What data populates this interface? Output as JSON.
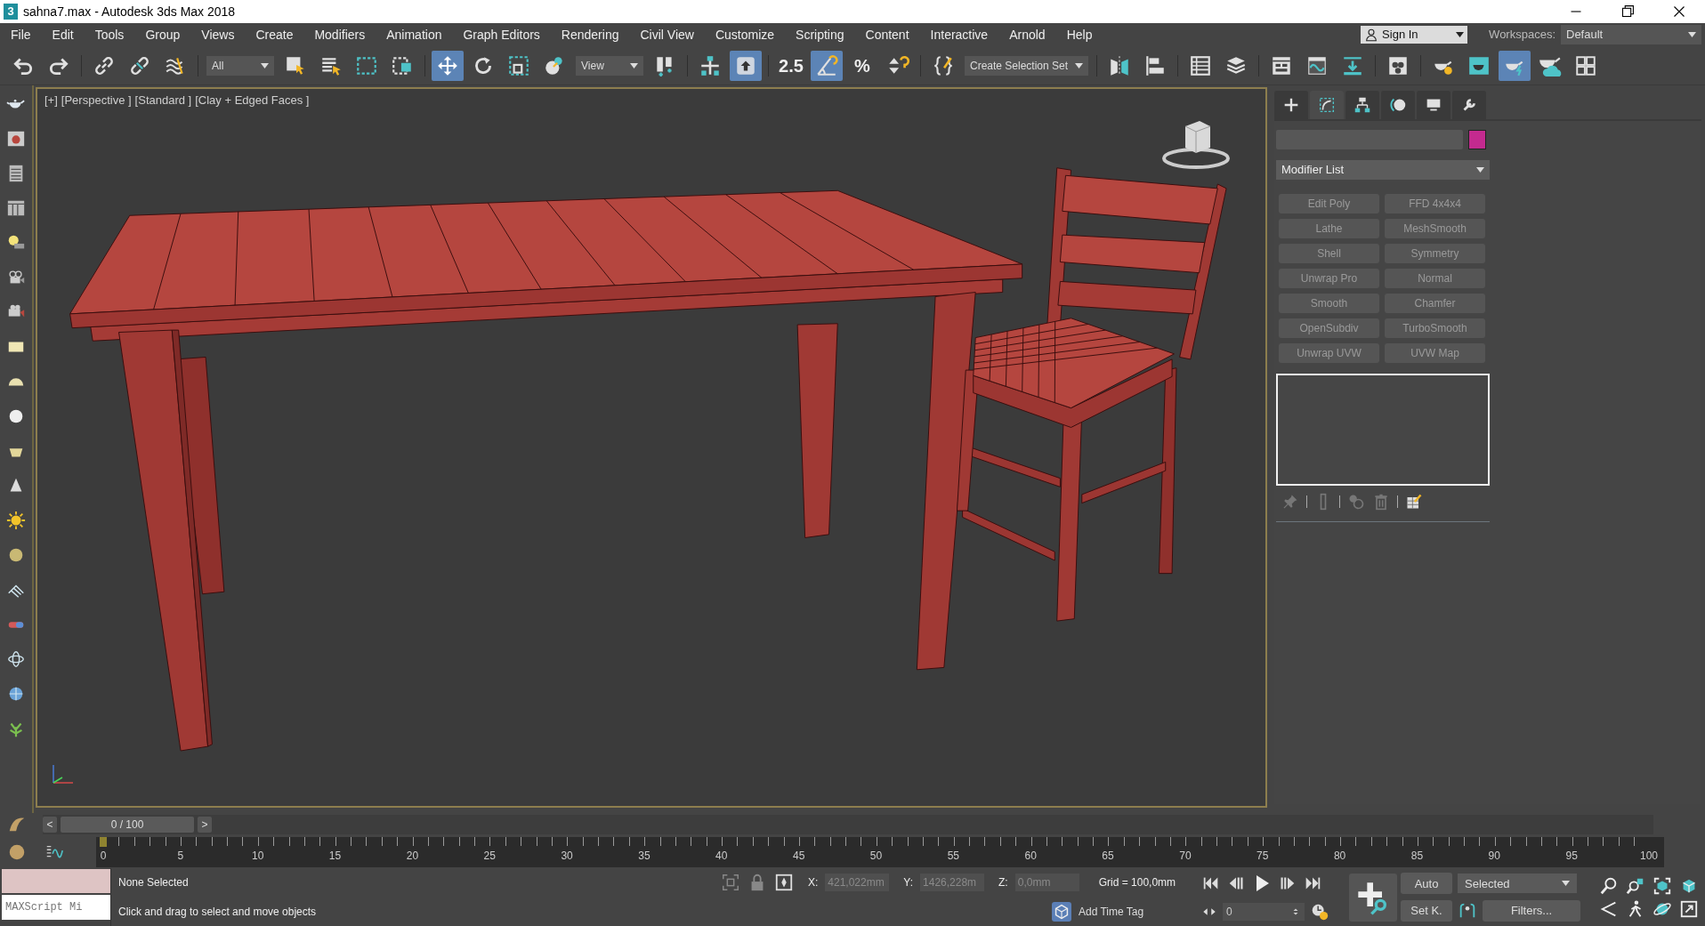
{
  "window": {
    "logo": "3",
    "title": "sahna7.max - Autodesk 3ds Max 2018"
  },
  "menu": [
    "File",
    "Edit",
    "Tools",
    "Group",
    "Views",
    "Create",
    "Modifiers",
    "Animation",
    "Graph Editors",
    "Rendering",
    "Civil View",
    "Customize",
    "Scripting",
    "Content",
    "Interactive",
    "Arnold",
    "Help"
  ],
  "account": {
    "label": "Sign In"
  },
  "workspaces": {
    "label": "Workspaces:",
    "value": "Default"
  },
  "toolbar": [
    {
      "kind": "icon",
      "on": false
    },
    {
      "kind": "icon",
      "on": false
    },
    {
      "kind": "separator"
    },
    {
      "kind": "icon",
      "on": false
    },
    {
      "kind": "icon",
      "on": false
    },
    {
      "kind": "icon",
      "on": false
    },
    {
      "kind": "separator"
    },
    {
      "kind": "dropdown",
      "value": "All"
    },
    {
      "kind": "icon",
      "on": false
    },
    {
      "kind": "icon",
      "on": false
    },
    {
      "kind": "icon",
      "on": false
    },
    {
      "kind": "icon",
      "on": false
    },
    {
      "kind": "separator"
    },
    {
      "kind": "icon",
      "on": true
    },
    {
      "kind": "icon",
      "on": false
    },
    {
      "kind": "icon",
      "on": false
    },
    {
      "kind": "icon",
      "on": false
    },
    {
      "kind": "dropdown",
      "value": "View"
    },
    {
      "kind": "icon",
      "on": false
    },
    {
      "kind": "separator"
    },
    {
      "kind": "icon",
      "on": false
    },
    {
      "kind": "icon",
      "on": true
    },
    {
      "kind": "separator"
    },
    {
      "kind": "text",
      "label": "2.5",
      "on": false
    },
    {
      "kind": "icon",
      "on": true
    },
    {
      "kind": "text",
      "label": "%",
      "on": false
    },
    {
      "kind": "icon",
      "on": false
    },
    {
      "kind": "separator"
    },
    {
      "kind": "icon",
      "on": false
    },
    {
      "kind": "dropdown",
      "value": "Create Selection Set"
    },
    {
      "kind": "separator"
    },
    {
      "kind": "icon",
      "on": false
    },
    {
      "kind": "icon",
      "on": false
    },
    {
      "kind": "separator"
    },
    {
      "kind": "icon",
      "on": false
    },
    {
      "kind": "icon",
      "on": false
    },
    {
      "kind": "separator"
    },
    {
      "kind": "icon",
      "on": false
    },
    {
      "kind": "icon",
      "on": false
    },
    {
      "kind": "icon",
      "on": false
    },
    {
      "kind": "separator"
    },
    {
      "kind": "icon",
      "on": false
    },
    {
      "kind": "separator"
    },
    {
      "kind": "icon",
      "on": false
    },
    {
      "kind": "icon",
      "on": false
    },
    {
      "kind": "icon",
      "on": true
    },
    {
      "kind": "icon",
      "on": false
    },
    {
      "kind": "icon",
      "on": false
    }
  ],
  "viewport": {
    "labels": [
      "[+]",
      "[Perspective ]",
      "[Standard ]",
      "[Clay + Edged Faces ]"
    ]
  },
  "command_panel": {
    "tabs": [
      {
        "selected": false
      },
      {
        "selected": true
      },
      {
        "selected": false
      },
      {
        "selected": false
      },
      {
        "selected": false
      },
      {
        "selected": false
      }
    ],
    "modifier_list": "Modifier List",
    "modifiers": [
      "Edit Poly",
      "FFD 4x4x4",
      "Lathe",
      "MeshSmooth",
      "Shell",
      "Symmetry",
      "Unwrap Pro",
      "Normal",
      "Smooth",
      "Chamfer",
      "OpenSubdiv",
      "TurboSmooth",
      "Unwrap UVW",
      "UVW Map"
    ]
  },
  "time_slider": {
    "prev": "<",
    "value": "0 / 100",
    "next": ">",
    "level": 0
  },
  "ruler": {
    "labels": [
      "0",
      "5",
      "10",
      "15",
      "20",
      "25",
      "30",
      "35",
      "40",
      "45",
      "50",
      "55",
      "60",
      "65",
      "70",
      "75",
      "80",
      "85",
      "90",
      "95",
      "100"
    ]
  },
  "maxscript": {
    "text": "MAXScript Mi"
  },
  "status": {
    "selection": "None Selected",
    "prompt": "Click and drag to select and move objects"
  },
  "coordinates": [
    {
      "label": "X:",
      "value": "421,022mm",
      "disabled": true
    },
    {
      "label": "Y:",
      "value": "1426,228m",
      "disabled": true
    },
    {
      "label": "Z:",
      "value": "0,0mm",
      "disabled": true
    }
  ],
  "grid": "Grid = 100,0mm",
  "time_tag": "Add Time Tag",
  "frame": "0",
  "keying": {
    "auto": "Auto",
    "key_set": "Selected",
    "set_key": "Set K.",
    "filters": "Filters..."
  }
}
